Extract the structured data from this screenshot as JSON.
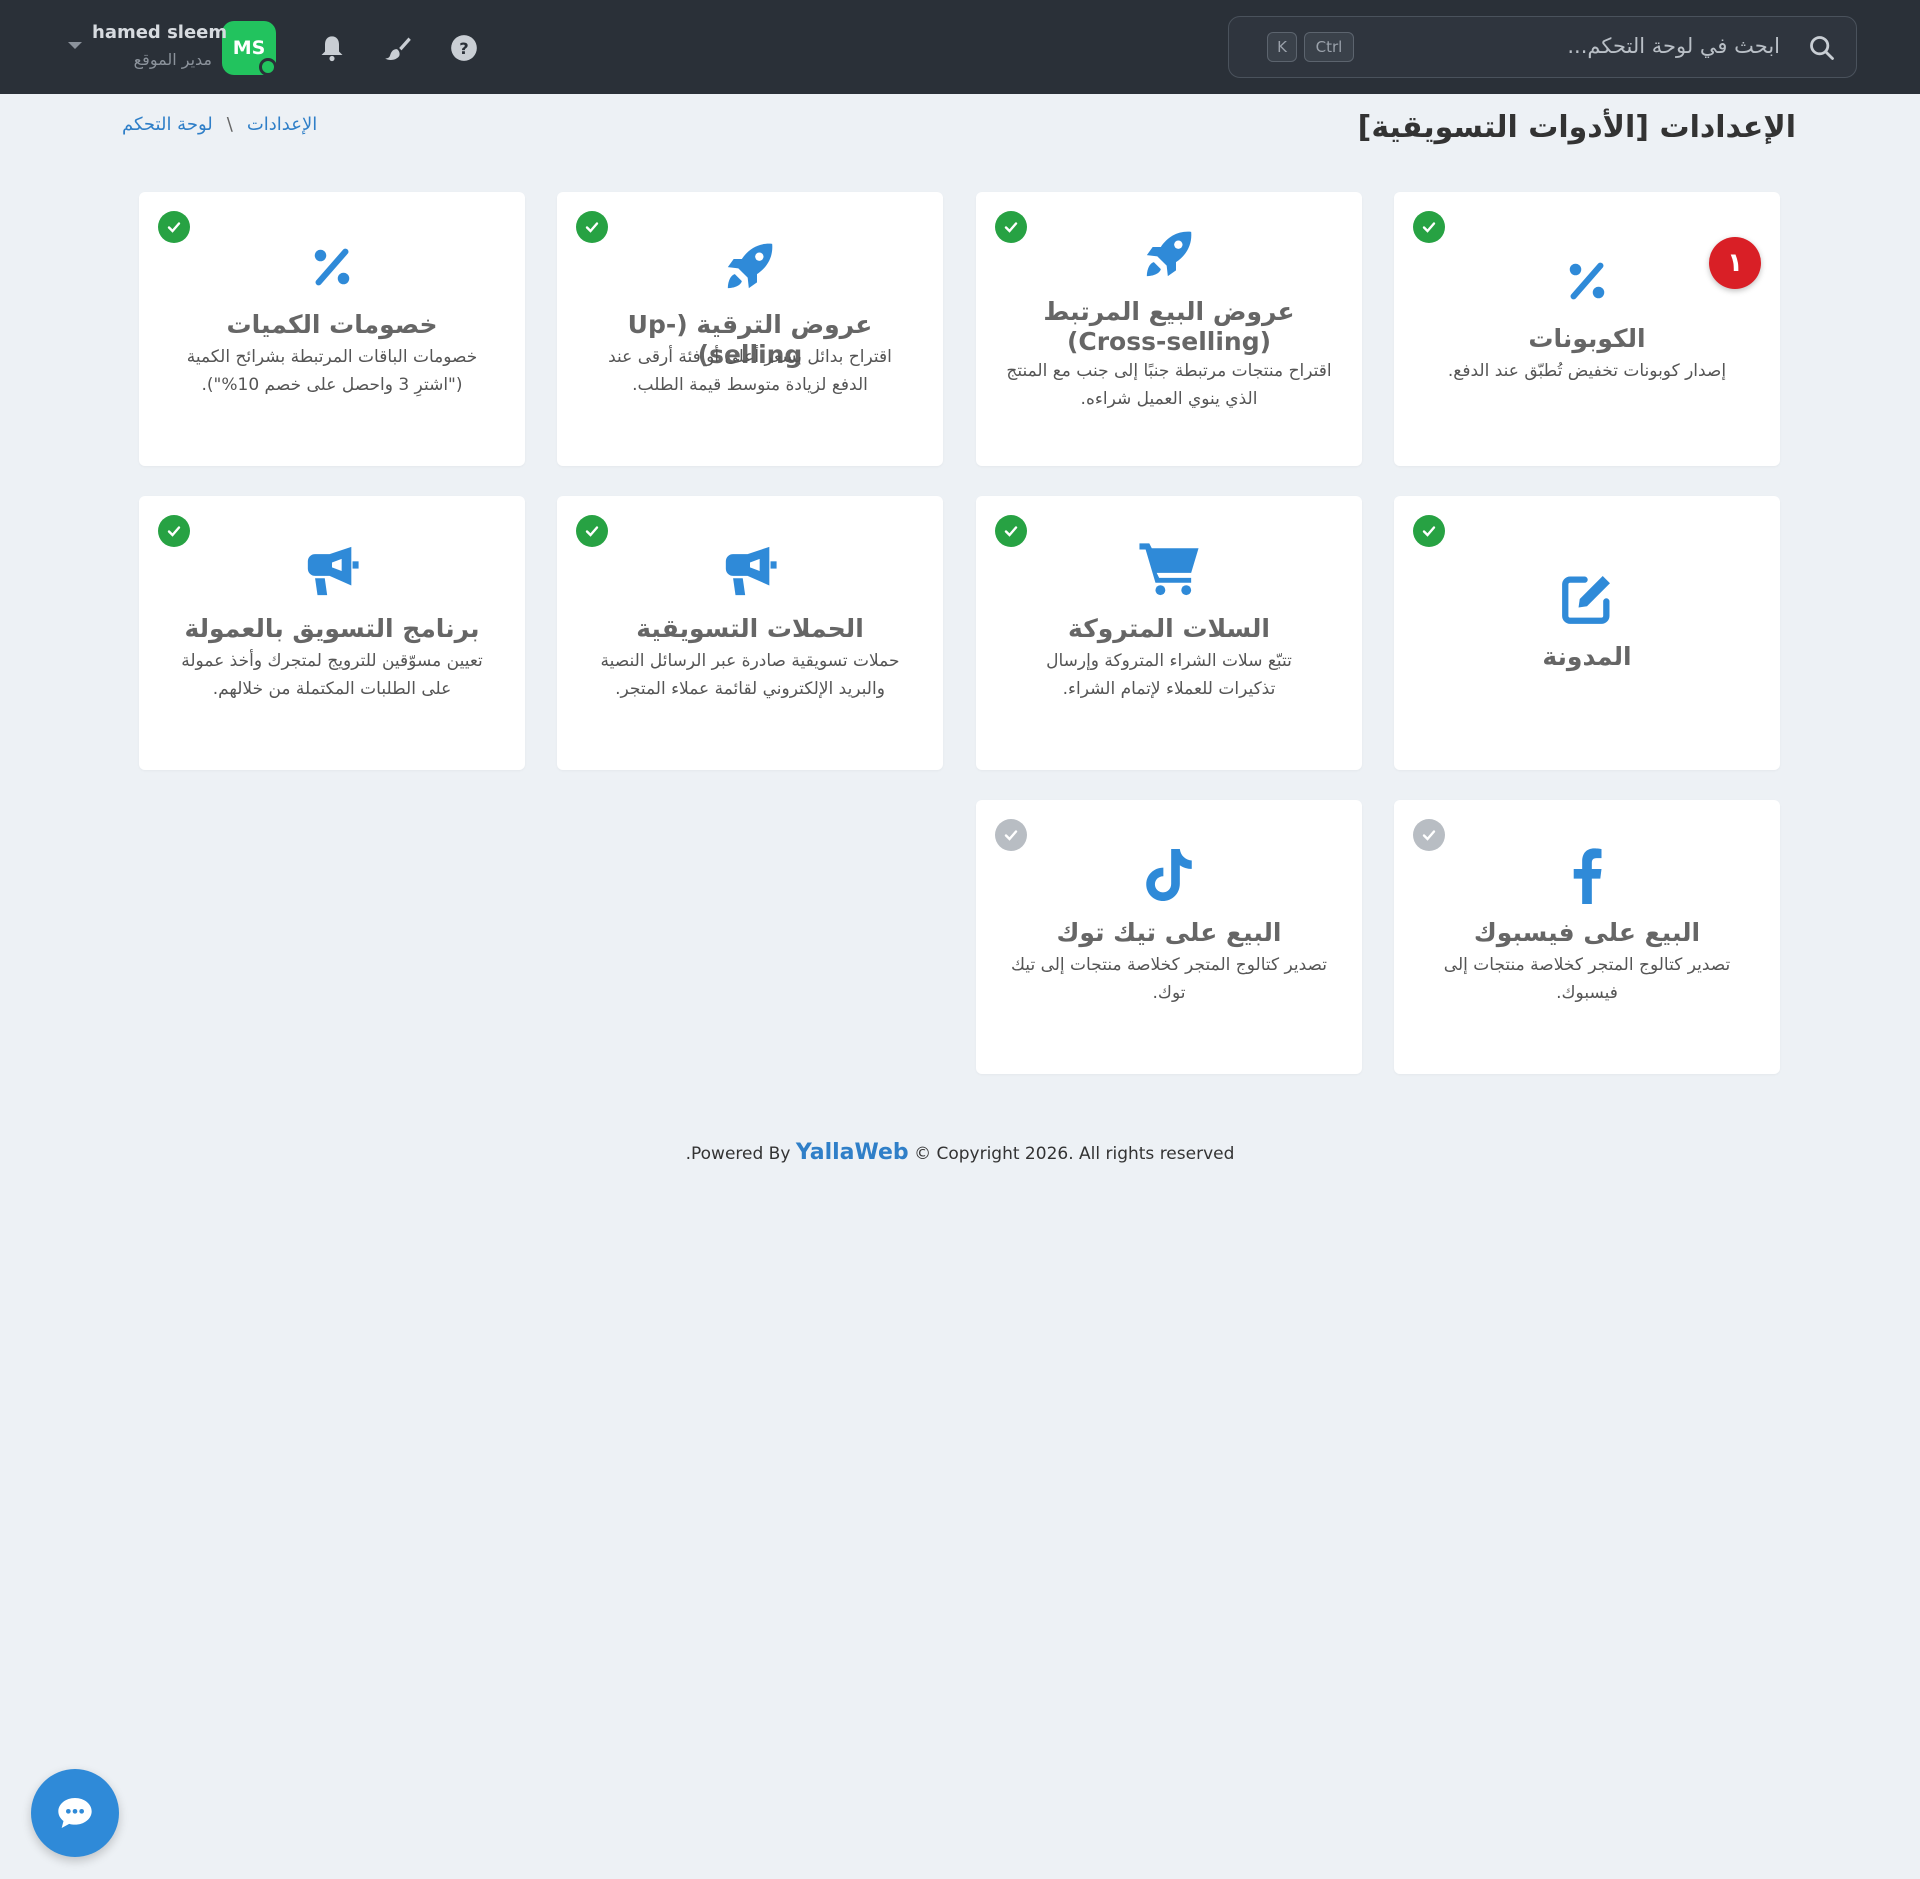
{
  "header": {
    "search_placeholder": "ابحث في لوحة التحكم...",
    "shortcut_keys": [
      "K",
      "Ctrl"
    ],
    "user_name": "hamed sleem",
    "user_role": "مدير الموقع",
    "avatar_initials": "MS",
    "icons": [
      "search-icon",
      "bell-icon",
      "brush-icon",
      "help-icon",
      "chevron-down-icon"
    ]
  },
  "page": {
    "title": "الإعدادات [الأدوات التسويقية]",
    "breadcrumb": [
      "لوحة التحكم",
      "الإعدادات"
    ],
    "breadcrumb_separator": "\\"
  },
  "cards": [
    {
      "title": "الكوبونات",
      "desc": "إصدار كوبونات تخفيض تُطبّق عند الدفع.",
      "icon": "percent-icon",
      "enabled": true,
      "badge": "١"
    },
    {
      "title": "عروض البيع المرتبط (Cross-selling)",
      "desc": "اقتراح منتجات مرتبطة جنبًا إلى جنب مع المنتج الذي ينوي العميل شراءه.",
      "icon": "rocket-icon",
      "enabled": true
    },
    {
      "title": "عروض الترقية (Up-selling)",
      "desc": "اقتراح بدائل بسعر أعلى أو فئة أرقى عند الدفع لزيادة متوسط قيمة الطلب.",
      "icon": "rocket-icon",
      "enabled": true
    },
    {
      "title": "خصومات الكميات",
      "desc": "خصومات الباقات المرتبطة بشرائح الكمية (\"اشترِ 3 واحصل على خصم 10%\").",
      "icon": "percent-icon",
      "enabled": true
    },
    {
      "title": "المدونة",
      "desc": "",
      "icon": "edit-icon",
      "enabled": true
    },
    {
      "title": "السلات المتروكة",
      "desc": "تتبّع سلات الشراء المتروكة وإرسال تذكيرات للعملاء لإتمام الشراء.",
      "icon": "cart-icon",
      "enabled": true
    },
    {
      "title": "الحملات التسويقية",
      "desc": "حملات تسويقية صادرة عبر الرسائل النصية والبريد الإلكتروني لقائمة عملاء المتجر.",
      "icon": "megaphone-icon",
      "enabled": true
    },
    {
      "title": "برنامج التسويق بالعمولة",
      "desc": "تعيين مسوّقين للترويج لمتجرك وأخذ عمولة على الطلبات المكتملة من خلالهم.",
      "icon": "megaphone-icon",
      "enabled": true
    },
    {
      "title": "البيع على فيسبوك",
      "desc": "تصدير كتالوج المتجر كخلاصة منتجات إلى فيسبوك.",
      "icon": "facebook-icon",
      "enabled": false
    },
    {
      "title": "البيع على تيك توك",
      "desc": "تصدير كتالوج المتجر كخلاصة منتجات إلى تيك توك.",
      "icon": "tiktok-icon",
      "enabled": false
    }
  ],
  "footer": {
    "prefix": ".Powered By",
    "brand": "YallaWeb",
    "suffix": "© Copyright 2026. All rights reserved"
  },
  "colors": {
    "topbar": "#2a3038",
    "background": "#edf1f5",
    "accent": "#2f8ad8",
    "enabled_check": "#27a243",
    "disabled_check": "#b8bdc3",
    "badge": "#d91f26",
    "avatar": "#22c35e"
  }
}
